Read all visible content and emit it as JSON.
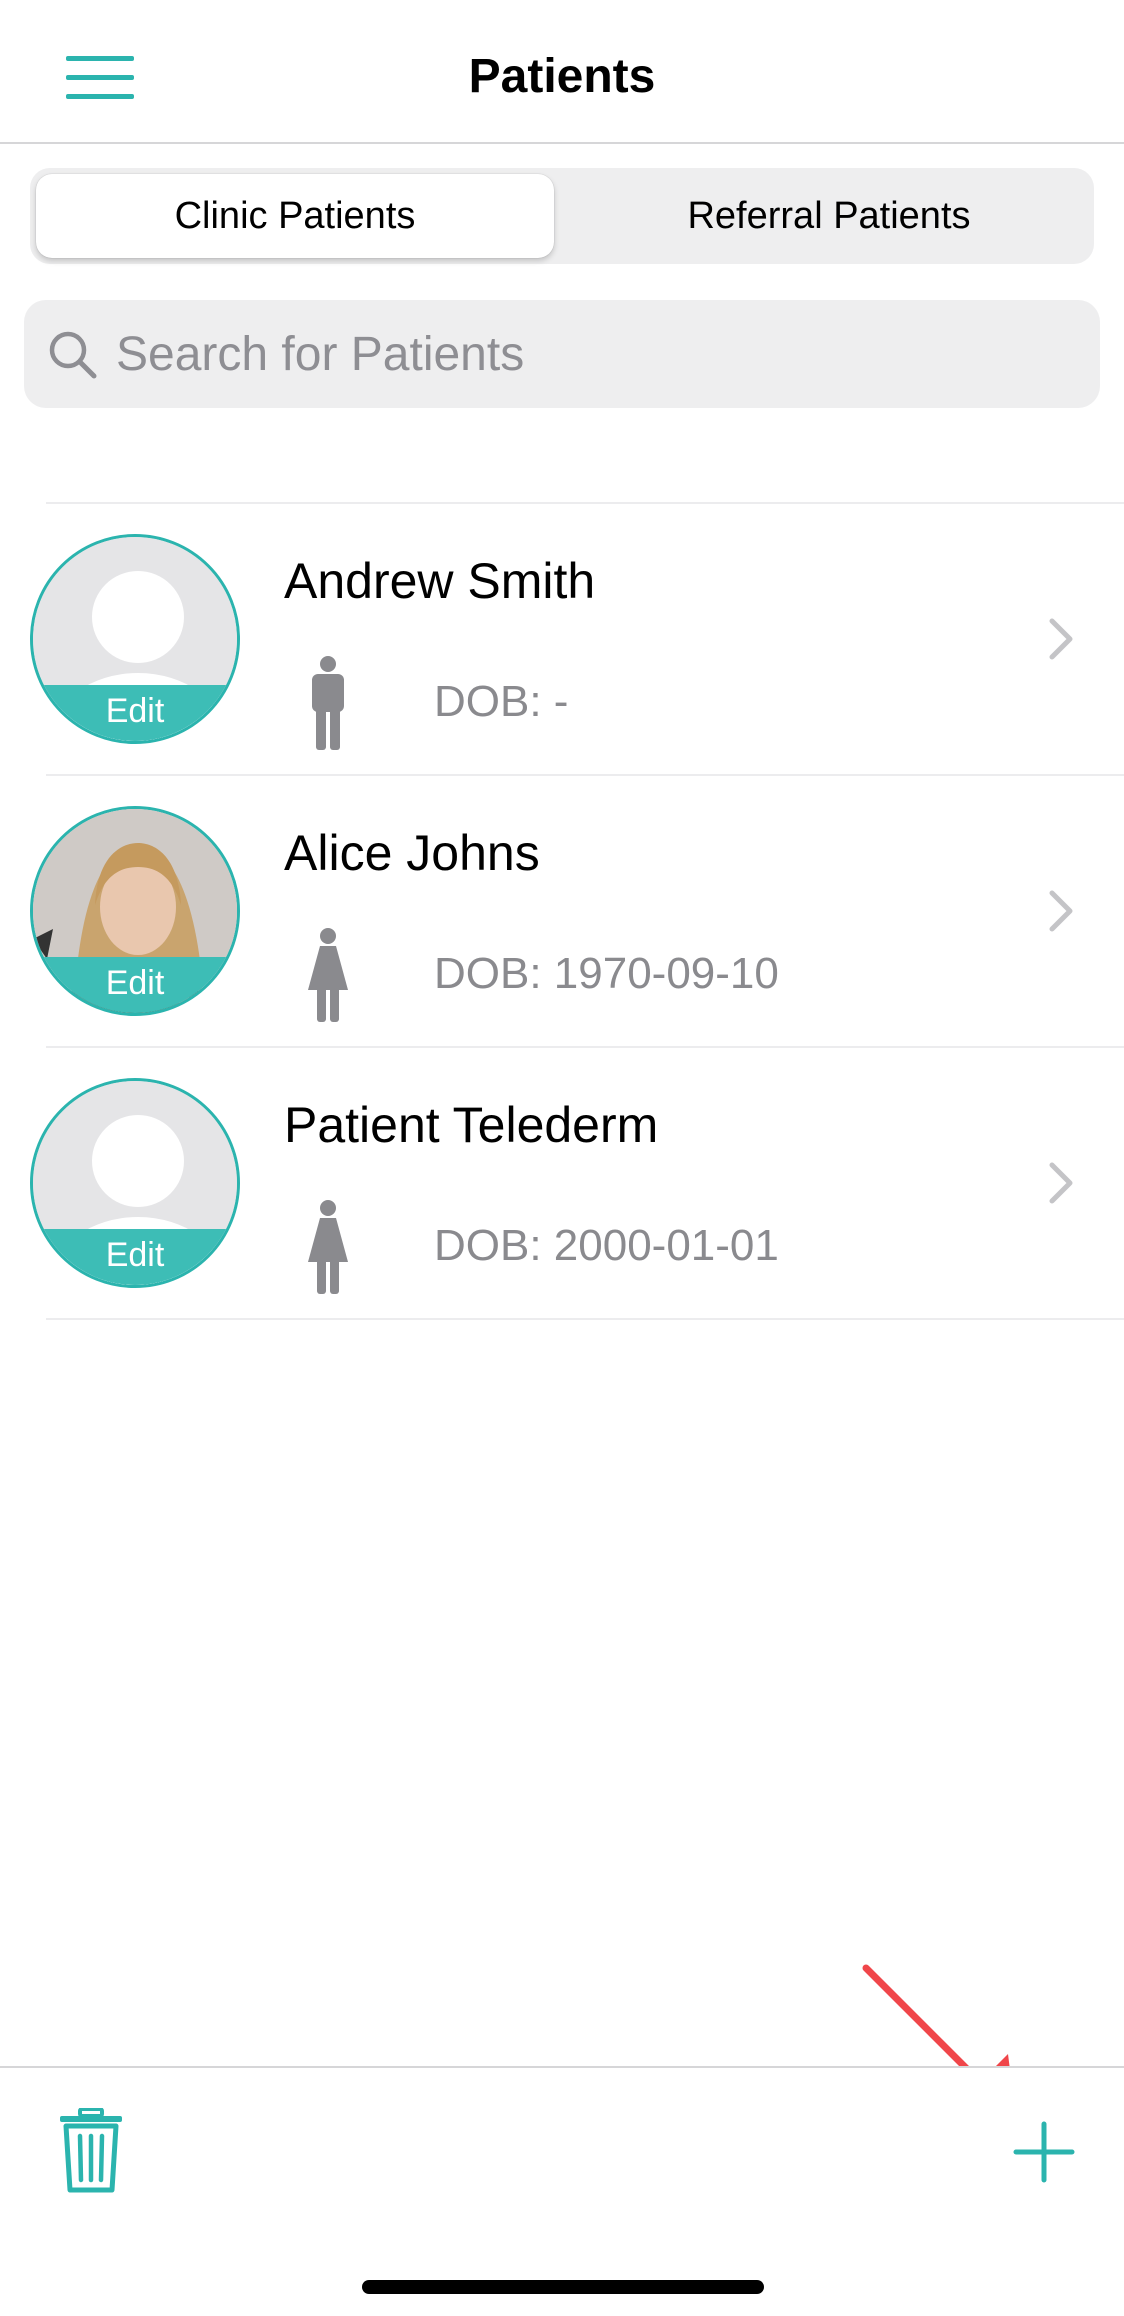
{
  "header": {
    "title": "Patients",
    "menu_icon": "hamburger-menu-icon"
  },
  "tabs": [
    {
      "label": "Clinic Patients",
      "selected": true
    },
    {
      "label": "Referral Patients",
      "selected": false
    }
  ],
  "search": {
    "placeholder": "Search for Patients",
    "value": ""
  },
  "patients": [
    {
      "name": "Andrew Smith",
      "dob": "DOB: -",
      "gender": "male",
      "avatar": "placeholder",
      "edit_label": "Edit"
    },
    {
      "name": "Alice Johns",
      "dob": "DOB: 1970-09-10",
      "gender": "female",
      "avatar": "photo",
      "edit_label": "Edit"
    },
    {
      "name": "Patient Telederm",
      "dob": "DOB: 2000-01-01",
      "gender": "female",
      "avatar": "placeholder",
      "edit_label": "Edit"
    }
  ],
  "toolbar": {
    "delete_icon": "trash-icon",
    "add_icon": "plus-icon"
  },
  "colors": {
    "accent": "#2bb4ae",
    "avatar_band": "#3dbdb6",
    "secondary_text": "#8a8a8e",
    "annotation": "#f0464a"
  }
}
